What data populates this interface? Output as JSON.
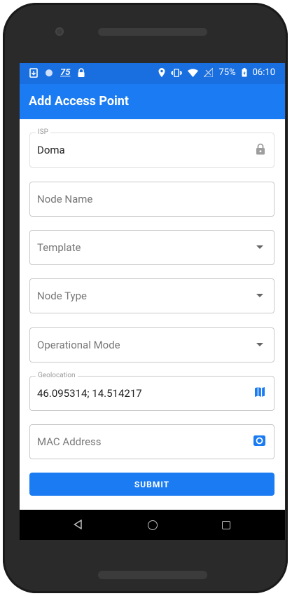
{
  "status_bar": {
    "left_icons": [
      "download-icon",
      "circle-icon",
      "notification-number-icon",
      "lock-icon"
    ],
    "notification_number": "75",
    "battery_percent": "75%",
    "time": "06:10",
    "right_icons": [
      "location-icon",
      "vibrate-icon",
      "wifi-icon",
      "signal-icon",
      "battery-icon"
    ]
  },
  "app_bar": {
    "title": "Add Access Point"
  },
  "form": {
    "isp": {
      "label": "ISP",
      "value": "Doma",
      "icon": "lock-icon"
    },
    "node_name": {
      "placeholder": "Node Name"
    },
    "template": {
      "placeholder": "Template",
      "icon": "dropdown-arrow-icon"
    },
    "node_type": {
      "placeholder": "Node Type",
      "icon": "dropdown-arrow-icon"
    },
    "operational_mode": {
      "placeholder": "Operational Mode",
      "icon": "dropdown-arrow-icon"
    },
    "geolocation": {
      "label": "Geolocation",
      "value": "46.095314; 14.514217",
      "icon": "map-icon"
    },
    "mac_address": {
      "placeholder": "MAC Address",
      "icon": "camera-icon"
    },
    "submit_label": "SUBMIT"
  },
  "nav_bar": {
    "icons": [
      "back-icon",
      "home-icon",
      "recent-apps-icon"
    ]
  },
  "colors": {
    "primary": "#1a7bf2",
    "status_bar": "#1a6fe0",
    "icon_blue": "#1a7bf2"
  }
}
